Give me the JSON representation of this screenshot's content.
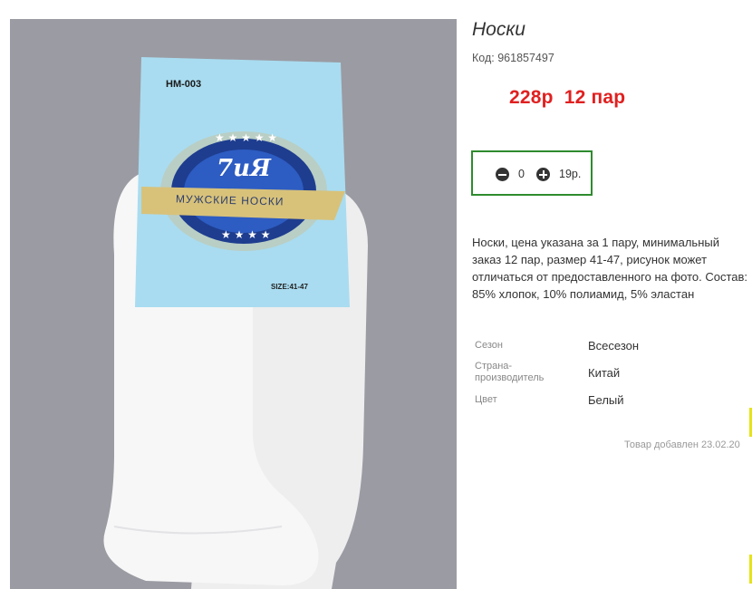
{
  "product": {
    "title": "Носки",
    "code_label": "Код:",
    "code_value": "961857497",
    "price_text": "228р  12 пар",
    "quantity": {
      "value": "0",
      "unit_price": "19р."
    },
    "description": "Носки, цена указана за 1 пару, минимальный заказ 12 пар, размер 41-47, рисунок может отличаться от предоставленного на фото. Состав: 85% хлопок, 10% полиамид, 5% эластан",
    "properties": [
      {
        "label": "Сезон",
        "value": "Всесезон"
      },
      {
        "label": "Страна-производитель",
        "value": "Китай"
      },
      {
        "label": "Цвет",
        "value": "Белый"
      }
    ],
    "added_text": "Товар добавлен 23.02.20"
  },
  "package_label": {
    "model": "HM-003",
    "brand": "7иЯ",
    "banner": "МУЖСКИЕ НОСКИ",
    "size": "SIZE:41-47"
  },
  "colors": {
    "price": "#e02020",
    "qty_border": "#2e8b2e",
    "photo_bg": "#9b9ba3",
    "label_blue": "#a9dcf0",
    "emblem_blue": "#1e3d8f",
    "banner_gold": "#d8c27a"
  }
}
